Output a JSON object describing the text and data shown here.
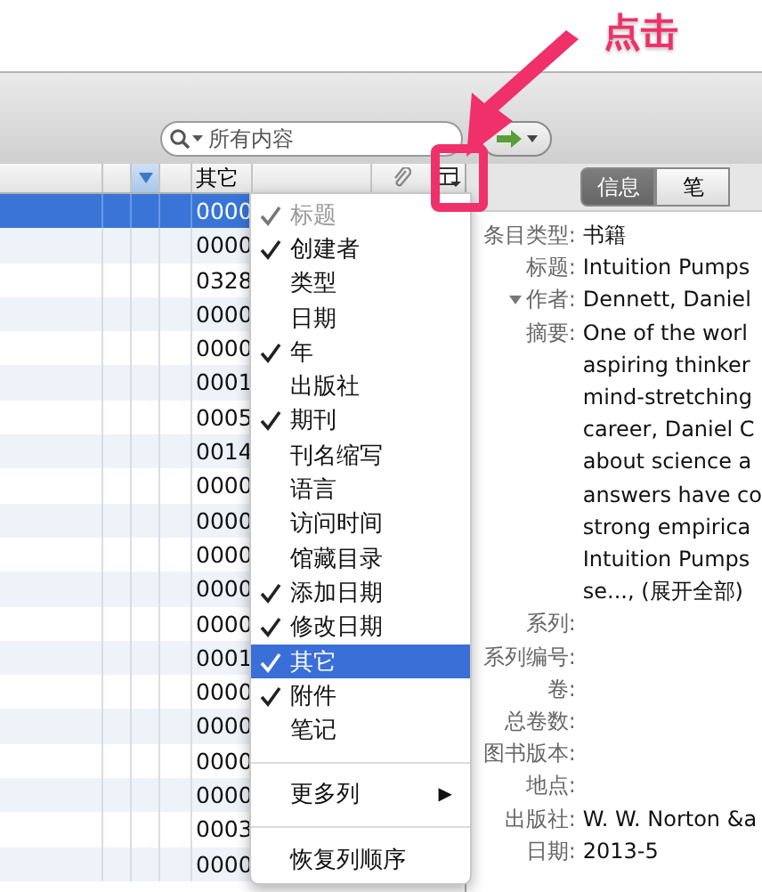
{
  "annotation": {
    "label": "点击"
  },
  "search": {
    "placeholder": "所有内容"
  },
  "table": {
    "columns": [
      {
        "sorted": false
      },
      {
        "sorted": false
      },
      {
        "sorted": true
      },
      {
        "sorted": false
      },
      {
        "label": "其它",
        "sorted": false
      }
    ],
    "rows": [
      {
        "other": "0000",
        "selected": true
      },
      {
        "other": "0000",
        "selected": false
      },
      {
        "other": "0328",
        "selected": false
      },
      {
        "other": "0000",
        "selected": false
      },
      {
        "other": "0000",
        "selected": false
      },
      {
        "other": "0001",
        "selected": false
      },
      {
        "other": "0005",
        "selected": false
      },
      {
        "other": "0014",
        "selected": false
      },
      {
        "other": "0000",
        "selected": false
      },
      {
        "other": "0000",
        "selected": false
      },
      {
        "other": "0000",
        "selected": false
      },
      {
        "other": "0000",
        "selected": false
      },
      {
        "other": "0000",
        "selected": false
      },
      {
        "other": "0001",
        "selected": false
      },
      {
        "other": "0000",
        "selected": false
      },
      {
        "other": "0000",
        "selected": false
      },
      {
        "other": "0000",
        "selected": false
      },
      {
        "other": "0000",
        "selected": false
      },
      {
        "other": "0003",
        "selected": false
      },
      {
        "other": "0000",
        "selected": false
      }
    ]
  },
  "column_menu": [
    {
      "kind": "item",
      "label": "标题",
      "checked": true,
      "disabled": true,
      "selected": false
    },
    {
      "kind": "item",
      "label": "创建者",
      "checked": true,
      "disabled": false,
      "selected": false
    },
    {
      "kind": "item",
      "label": "类型",
      "checked": false,
      "disabled": false,
      "selected": false
    },
    {
      "kind": "item",
      "label": "日期",
      "checked": false,
      "disabled": false,
      "selected": false
    },
    {
      "kind": "item",
      "label": "年",
      "checked": true,
      "disabled": false,
      "selected": false
    },
    {
      "kind": "item",
      "label": "出版社",
      "checked": false,
      "disabled": false,
      "selected": false
    },
    {
      "kind": "item",
      "label": "期刊",
      "checked": true,
      "disabled": false,
      "selected": false
    },
    {
      "kind": "item",
      "label": "刊名缩写",
      "checked": false,
      "disabled": false,
      "selected": false
    },
    {
      "kind": "item",
      "label": "语言",
      "checked": false,
      "disabled": false,
      "selected": false
    },
    {
      "kind": "item",
      "label": "访问时间",
      "checked": false,
      "disabled": false,
      "selected": false
    },
    {
      "kind": "item",
      "label": "馆藏目录",
      "checked": false,
      "disabled": false,
      "selected": false
    },
    {
      "kind": "item",
      "label": "添加日期",
      "checked": true,
      "disabled": false,
      "selected": false
    },
    {
      "kind": "item",
      "label": "修改日期",
      "checked": true,
      "disabled": false,
      "selected": false
    },
    {
      "kind": "item",
      "label": "其它",
      "checked": true,
      "disabled": false,
      "selected": true
    },
    {
      "kind": "item",
      "label": "附件",
      "checked": true,
      "disabled": false,
      "selected": false
    },
    {
      "kind": "item",
      "label": "笔记",
      "checked": false,
      "disabled": false,
      "selected": false
    },
    {
      "kind": "separator"
    },
    {
      "kind": "submenu",
      "label": "更多列",
      "arrow": "▶"
    },
    {
      "kind": "separator"
    },
    {
      "kind": "item",
      "label": "恢复列顺序",
      "checked": false,
      "disabled": false,
      "selected": false
    }
  ],
  "pane_tabs": [
    {
      "label": "信息",
      "selected": true
    },
    {
      "label": "笔",
      "selected": false
    }
  ],
  "fields": [
    {
      "label": "条目类型:",
      "expandable": false,
      "lines": [
        "书籍"
      ]
    },
    {
      "label": "标题:",
      "expandable": false,
      "lines": [
        "Intuition Pumps"
      ]
    },
    {
      "label": "作者:",
      "expandable": true,
      "lines": [
        "Dennett, Daniel"
      ]
    },
    {
      "label": "摘要:",
      "expandable": false,
      "lines": [
        "One of the worl",
        "aspiring thinker",
        "mind-stretching",
        "career, Daniel C",
        "about science a",
        "answers have co",
        "strong empirica",
        "Intuition Pumps",
        "se..., (展开全部)"
      ]
    },
    {
      "label": "系列:",
      "expandable": false
    },
    {
      "label": "系列编号:",
      "expandable": false
    },
    {
      "label": "卷:",
      "expandable": false
    },
    {
      "label": "总卷数:",
      "expandable": false
    },
    {
      "label": "图书版本:",
      "expandable": false
    },
    {
      "label": "地点:",
      "expandable": false
    },
    {
      "label": "出版社:",
      "expandable": false,
      "lines": [
        "W. W. Norton &a"
      ]
    },
    {
      "label": "日期:",
      "expandable": false,
      "lines": [
        "2013-5"
      ]
    }
  ]
}
